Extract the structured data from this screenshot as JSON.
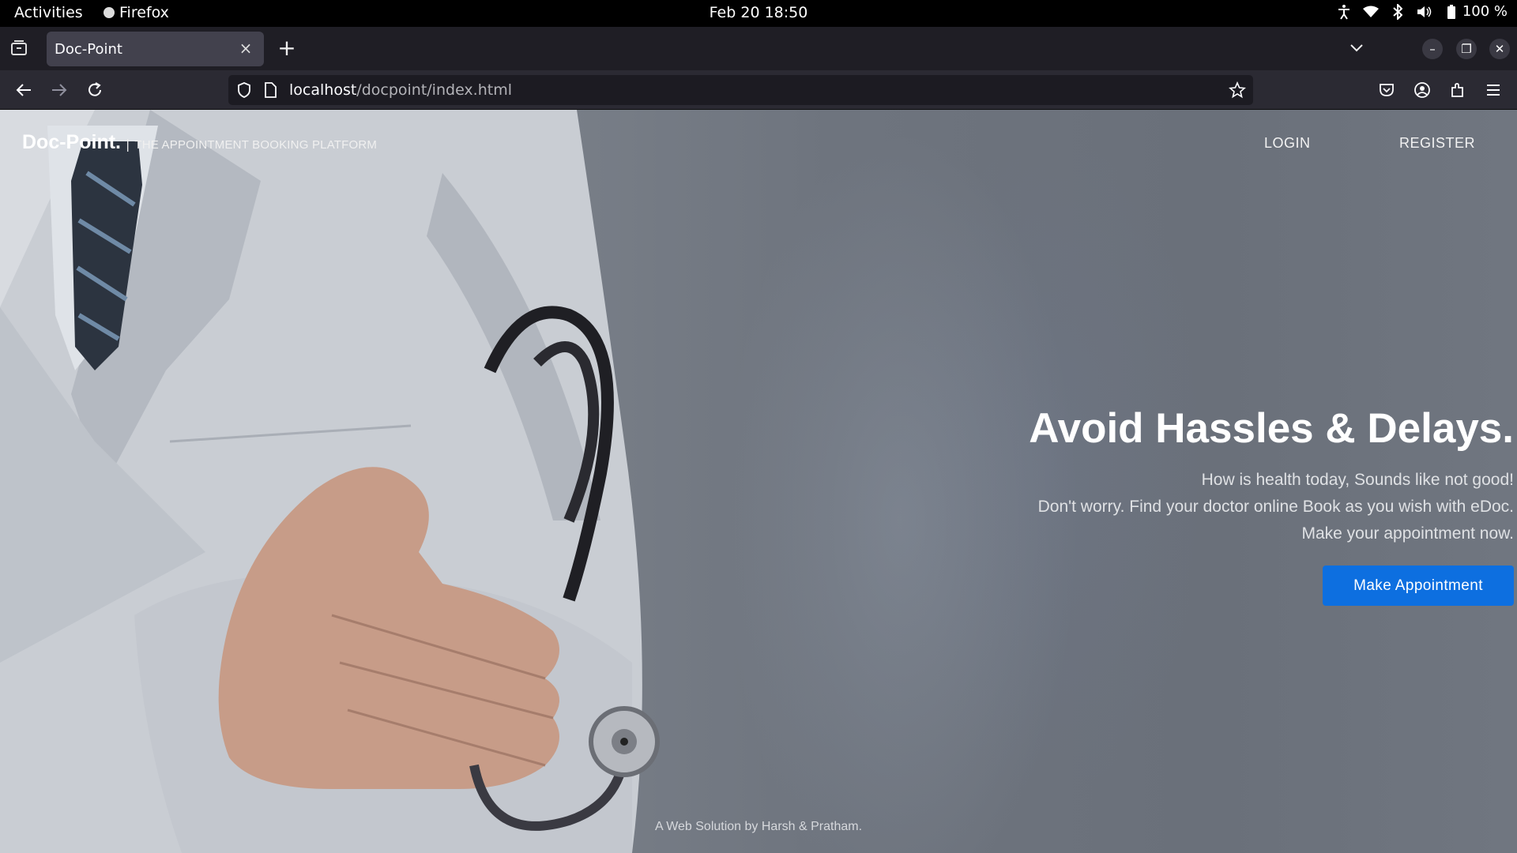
{
  "system": {
    "activities": "Activities",
    "app_name": "Firefox",
    "clock": "Feb 20  18:50",
    "battery": "100 %"
  },
  "browser": {
    "tab_title": "Doc-Point",
    "url_host": "localhost",
    "url_path": "/docpoint/index.html"
  },
  "site": {
    "brand": "Doc-Point.",
    "separator": "|",
    "tagline": "THE APPOINTMENT BOOKING PLATFORM",
    "nav": {
      "login": "LOGIN",
      "register": "REGISTER"
    },
    "hero": {
      "title": "Avoid Hassles & Delays.",
      "lines": [
        "How is health today, Sounds like not good!",
        "Don't worry. Find your doctor online Book as you wish with eDoc.",
        "Make your appointment now."
      ],
      "cta": "Make Appointment"
    },
    "footer": "A Web Solution by Harsh & Pratham."
  },
  "colors": {
    "cta_blue": "#0d6fe0",
    "hero_overlay": "#707680"
  },
  "icons": {
    "system_tray": [
      "accessibility-icon",
      "wifi-icon",
      "bluetooth-icon",
      "volume-icon",
      "battery-icon"
    ],
    "nav": [
      "back-arrow-icon",
      "forward-arrow-icon",
      "reload-icon",
      "shield-icon",
      "page-icon",
      "star-icon",
      "pocket-icon",
      "account-icon",
      "extensions-icon",
      "menu-icon"
    ]
  }
}
